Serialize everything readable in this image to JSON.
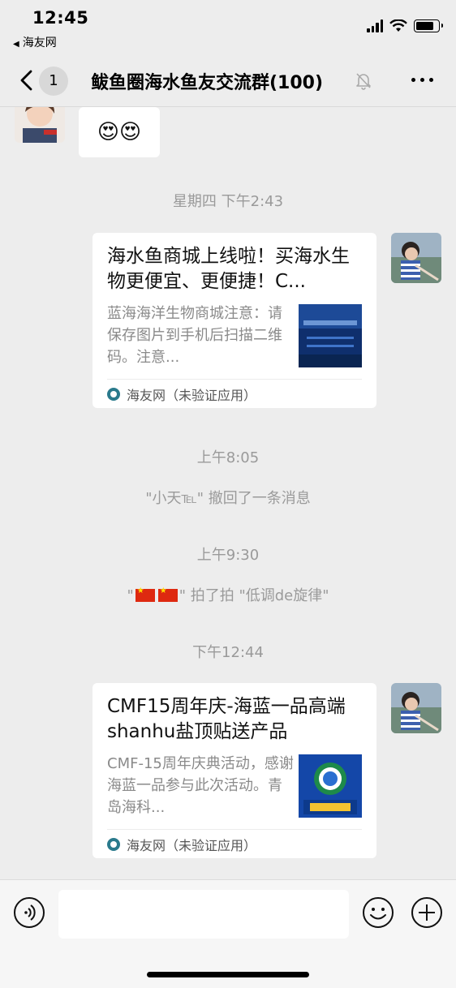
{
  "status_bar": {
    "time": "12:45",
    "back_app": "海友网"
  },
  "nav": {
    "unread_count": "1",
    "title": "鲅鱼圈海水鱼友交流群(100)",
    "icons": [
      "chevron-left-icon",
      "bell-mute-icon",
      "more-icon"
    ]
  },
  "messages": {
    "emoji_msg": "😍😍",
    "time1": "星期四 下午2:43",
    "card1": {
      "title": "海水鱼商城上线啦！买海水生物更便宜、更便捷！C...",
      "desc": "蓝海海洋生物商城注意：请保存图片到手机后扫描二维码。注意...",
      "source": "海友网（未验证应用）"
    },
    "time2": "上午8:05",
    "recall": "\"小天℡\" 撤回了一条消息",
    "time3": "上午9:30",
    "pat_prefix": "\"",
    "pat_suffix": "\" 拍了拍 \"低调de旋律\"",
    "time4": "下午12:44",
    "card2": {
      "title": "CMF15周年庆-海蓝一品高端shanhu盐顶贴送产品",
      "desc": "CMF-15周年庆典活动，感谢海蓝一品参与此次活动。青岛海科...",
      "source": "海友网（未验证应用）"
    }
  },
  "input_bar": {
    "icons": [
      "voice-icon",
      "emoji-icon",
      "plus-icon"
    ]
  }
}
